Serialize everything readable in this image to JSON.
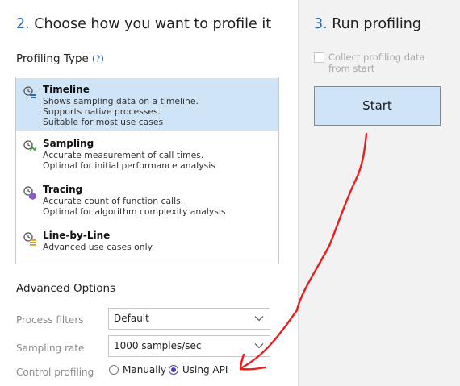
{
  "step2": {
    "num": "2.",
    "title": "Choose how you want to profile it"
  },
  "step3": {
    "num": "3.",
    "title": "Run profiling"
  },
  "profiling_type": {
    "label": "Profiling Type",
    "help": "(?)",
    "items": [
      {
        "name": "Timeline",
        "desc": [
          "Shows sampling data on a timeline.",
          "Supports native processes.",
          "Suitable for most use cases"
        ],
        "icon": "timeline-icon",
        "selected": true
      },
      {
        "name": "Sampling",
        "desc": [
          "Accurate measurement of call times.",
          "Optimal for initial performance analysis"
        ],
        "icon": "sampling-icon",
        "selected": false
      },
      {
        "name": "Tracing",
        "desc": [
          "Accurate count of function calls.",
          "Optimal for algorithm complexity analysis"
        ],
        "icon": "tracing-icon",
        "selected": false
      },
      {
        "name": "Line-by-Line",
        "desc": [
          "Advanced use cases only"
        ],
        "icon": "line-by-line-icon",
        "selected": false
      }
    ]
  },
  "advanced": {
    "label": "Advanced Options",
    "process_filters": {
      "label": "Process filters",
      "value": "Default"
    },
    "sampling_rate": {
      "label": "Sampling rate",
      "value": "1000 samples/sec"
    },
    "control_profiling": {
      "label": "Control profiling",
      "options": [
        "Manually",
        "Using API"
      ],
      "selected": "Using API"
    }
  },
  "run": {
    "collect_label": "Collect profiling data from start",
    "collect_checked": false,
    "start_label": "Start"
  },
  "colors": {
    "accent": "#2a6ab8",
    "selection": "#cfe4f7",
    "annotation": "#ee1c1c"
  }
}
